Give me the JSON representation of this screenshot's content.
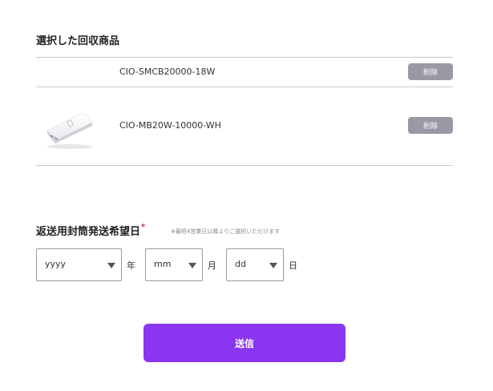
{
  "selected": {
    "title": "選択した回収商品",
    "items": [
      {
        "name": "CIO-SMCB20000-18W",
        "delete_label": "削除"
      },
      {
        "name": "CIO-MB20W-10000-WH",
        "delete_label": "削除",
        "image": "power-bank-white"
      }
    ]
  },
  "return_date": {
    "label": "返送用封筒発送希望日",
    "required_mark": "*",
    "note": "※最短4営業日以降よりご選択いただけます",
    "year": {
      "value": "yyyy",
      "unit": "年"
    },
    "month": {
      "value": "mm",
      "unit": "月"
    },
    "day": {
      "value": "dd",
      "unit": "日"
    }
  },
  "submit_label": "送信",
  "colors": {
    "accent": "#8a35ef",
    "delete_button": "#9a98a4",
    "required": "#e0245e",
    "divider": "#c9c9c9"
  }
}
